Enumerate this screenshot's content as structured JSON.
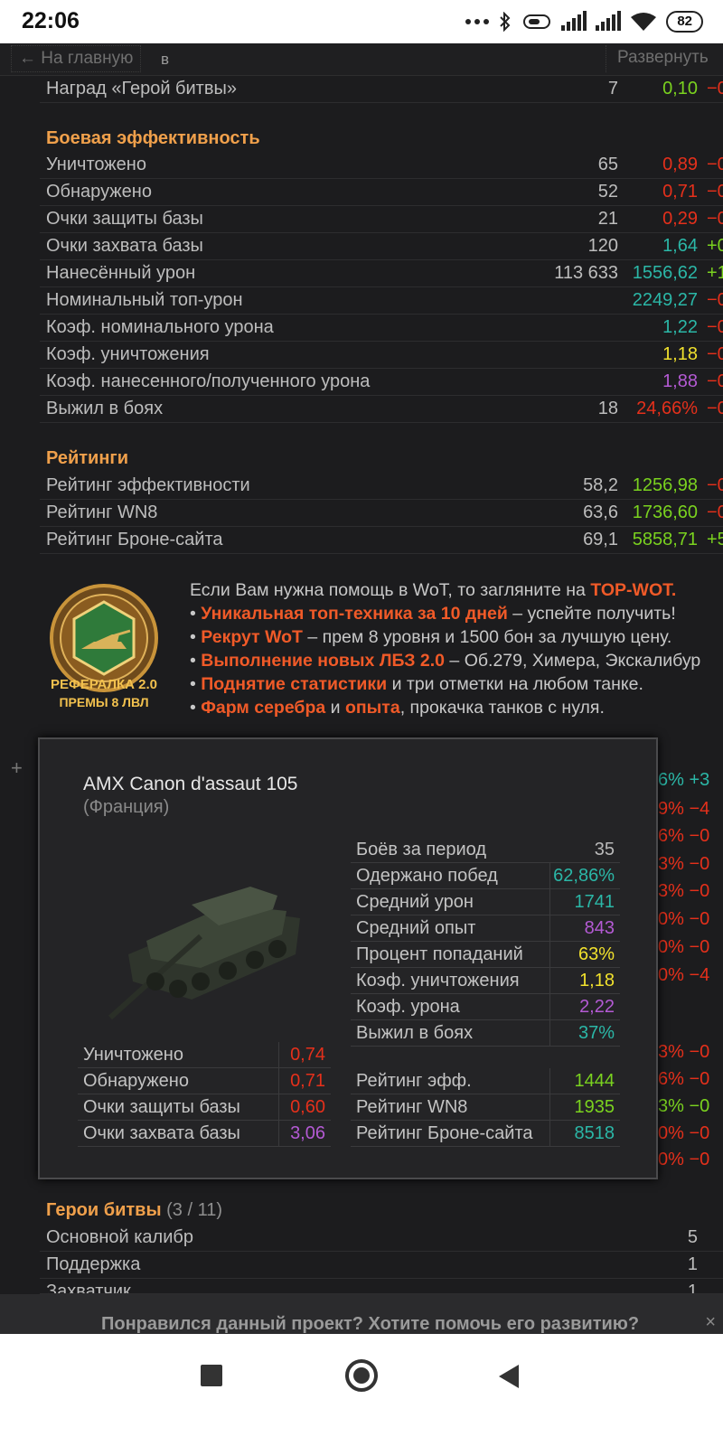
{
  "status_bar": {
    "time": "22:06",
    "battery": "82"
  },
  "nav": {
    "back_label": "← На главную",
    "letter": "в",
    "expand_label": "Развернуть"
  },
  "top_row": {
    "label": "Наград «Герой битвы»",
    "value": "7",
    "rate": "0,10",
    "delta": "−0"
  },
  "combat": {
    "title": "Боевая эффективность",
    "rows": [
      {
        "label": "Уничтожено",
        "value": "65",
        "rate": "0,89",
        "delta": "−0"
      },
      {
        "label": "Обнаружено",
        "value": "52",
        "rate": "0,71",
        "delta": "−0"
      },
      {
        "label": "Очки защиты базы",
        "value": "21",
        "rate": "0,29",
        "delta": "−0"
      },
      {
        "label": "Очки захвата базы",
        "value": "120",
        "rate": "1,64",
        "delta": "+0"
      },
      {
        "label": "Нанесённый урон",
        "value": "113 633",
        "rate": "1556,62",
        "delta": "+1"
      },
      {
        "label": "Номинальный топ-урон",
        "value": "",
        "rate": "2249,27",
        "delta": "−0"
      },
      {
        "label": "Коэф. номинального урона",
        "value": "",
        "rate": "1,22",
        "delta": "−0"
      },
      {
        "label": "Коэф. уничтожения",
        "value": "",
        "rate": "1,18",
        "delta": "−0"
      },
      {
        "label": "Коэф. нанесенного/полученного урона",
        "value": "",
        "rate": "1,88",
        "delta": "−0"
      },
      {
        "label": "Выжил в боях",
        "value": "18",
        "rate": "24,66%",
        "delta": "−0"
      }
    ]
  },
  "ratings": {
    "title": "Рейтинги",
    "rows": [
      {
        "label": "Рейтинг эффективности",
        "value": "58,2",
        "rate": "1256,98",
        "delta": "−0"
      },
      {
        "label": "Рейтинг WN8",
        "value": "63,6",
        "rate": "1736,60",
        "delta": "−0"
      },
      {
        "label": "Рейтинг Броне-сайта",
        "value": "69,1",
        "rate": "5858,71",
        "delta": "+5"
      }
    ]
  },
  "ad": {
    "logo_line1": "РЕФЕРАЛКА 2.0",
    "logo_line2": "ПРЕМЫ 8 ЛВЛ",
    "intro": "Если Вам нужна помощь в WoT, то загляните на ",
    "intro_hl": "TOP-WOT.",
    "b1_hl": "Уникальная топ-техника за 10 дней",
    "b1_rest": " – успейте получить!",
    "b2_hl": "Рекрут WoT",
    "b2_rest": " – прем 8 уровня и 1500 бон за лучшую цену.",
    "b3_hl": "Выполнение новых ЛБЗ 2.0",
    "b3_rest": " – Об.279, Химера, Экскалибур",
    "b4_hl": "Поднятие статистики",
    "b4_rest": " и три отметки на любом танке.",
    "b5_hl1": "Фарм серебра",
    "b5_mid": " и ",
    "b5_hl2": "опыта",
    "b5_rest": ", прокачка танков с нуля."
  },
  "bg_rows": [
    "6%  +3",
    "9%  −4",
    "6%  −0",
    "3%  −0",
    "3%  −0",
    "0%  −0",
    "0%  −0",
    "0%  −4",
    "3%  −0",
    "6%  −0",
    "3%  −0",
    "0%  −0",
    "0%  −0"
  ],
  "popup": {
    "tank_name": "AMX Canon d'assaut 105",
    "nation": "(Франция)",
    "right_stats": [
      {
        "label": "Боёв за период",
        "value": "35",
        "color": "#b9b9b9"
      },
      {
        "label": "Одержано побед",
        "value": "62,86%",
        "color": "#2bb7a7"
      },
      {
        "label": "Средний урон",
        "value": "1741",
        "color": "#2bb7a7"
      },
      {
        "label": "Средний опыт",
        "value": "843",
        "color": "#b45ad4"
      },
      {
        "label": "Процент попаданий",
        "value": "63%",
        "color": "#f1e12d"
      },
      {
        "label": "Коэф. уничтожения",
        "value": "1,18",
        "color": "#f1e12d"
      },
      {
        "label": "Коэф. урона",
        "value": "2,22",
        "color": "#b45ad4"
      },
      {
        "label": "Выжил в боях",
        "value": "37%",
        "color": "#2bb7a7"
      }
    ],
    "left_stats": [
      {
        "label": "Уничтожено",
        "value": "0,74",
        "color": "#e5301b"
      },
      {
        "label": "Обнаружено",
        "value": "0,71",
        "color": "#e5301b"
      },
      {
        "label": "Очки защиты базы",
        "value": "0,60",
        "color": "#e5301b"
      },
      {
        "label": "Очки захвата базы",
        "value": "3,06",
        "color": "#b45ad4"
      }
    ],
    "ratings": [
      {
        "label": "Рейтинг эфф.",
        "value": "1444",
        "color": "#7ad21f"
      },
      {
        "label": "Рейтинг WN8",
        "value": "1935",
        "color": "#7ad21f"
      },
      {
        "label": "Рейтинг Броне-сайта",
        "value": "8518",
        "color": "#2bb7a7"
      }
    ]
  },
  "heroes": {
    "title": "Герои битвы",
    "count": "(3 / 11)",
    "rows": [
      {
        "label": "Основной калибр",
        "value": "5"
      },
      {
        "label": "Поддержка",
        "value": "1"
      },
      {
        "label": "Захватчик",
        "value": "1"
      }
    ]
  },
  "banner": {
    "text": "Понравился данный проект? Хотите помочь его развитию?",
    "close": "×"
  },
  "colors": {
    "accent": "#f0a04b",
    "highlight": "#f05a28",
    "red": "#e5301b",
    "green": "#7ad21f",
    "teal": "#2bb7a7",
    "yellow": "#f1e12d",
    "purple": "#b45ad4"
  }
}
